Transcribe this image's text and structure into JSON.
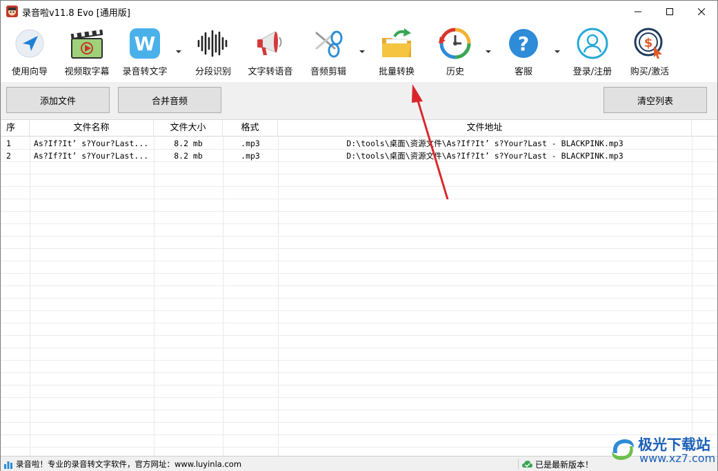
{
  "window": {
    "title": "录音啦v11.8 Evo [通用版]"
  },
  "toolbar": {
    "items": [
      {
        "label": "使用向导",
        "icon": "guide-arrow-icon"
      },
      {
        "label": "视频取字幕",
        "icon": "video-subtitle-icon"
      },
      {
        "label": "录音转文字",
        "icon": "speech-to-text-icon"
      },
      {
        "label": "分段识别",
        "icon": "waveform-icon"
      },
      {
        "label": "文字转语音",
        "icon": "megaphone-icon"
      },
      {
        "label": "音频剪辑",
        "icon": "scissors-icon"
      },
      {
        "label": "批量转换",
        "icon": "folder-convert-icon"
      },
      {
        "label": "历史",
        "icon": "history-clock-icon"
      },
      {
        "label": "客服",
        "icon": "help-icon"
      },
      {
        "label": "登录/注册",
        "icon": "user-icon"
      },
      {
        "label": "购买/激活",
        "icon": "purchase-icon"
      }
    ]
  },
  "actions": {
    "add_file": "添加文件",
    "merge_audio": "合并音频",
    "clear_list": "清空列表"
  },
  "table": {
    "columns": [
      "序",
      "文件名称",
      "文件大小",
      "格式",
      "文件地址"
    ],
    "rows": [
      {
        "index": "1",
        "name": "As?If?It’ s?Your?Last...",
        "size": "8.2 mb",
        "format": ".mp3",
        "path": "D:\\tools\\桌面\\资源文件\\As?If?It’ s?Your?Last - BLACKPINK.mp3"
      },
      {
        "index": "2",
        "name": "As?If?It’ s?Your?Last...",
        "size": "8.2 mb",
        "format": ".mp3",
        "path": "D:\\tools\\桌面\\资源文件\\As?If?It’ s?Your?Last - BLACKPINK.mp3"
      }
    ]
  },
  "status": {
    "left": "录音啦！专业的录音转文字软件，官方网址：www.luyinla.com",
    "right": "已是最新版本！"
  },
  "watermark": {
    "line1": "极光下载站",
    "line2": "www.xz7.com"
  },
  "colors": {
    "accent_blue": "#2d8bd8",
    "arrow_red": "#d9262b"
  }
}
